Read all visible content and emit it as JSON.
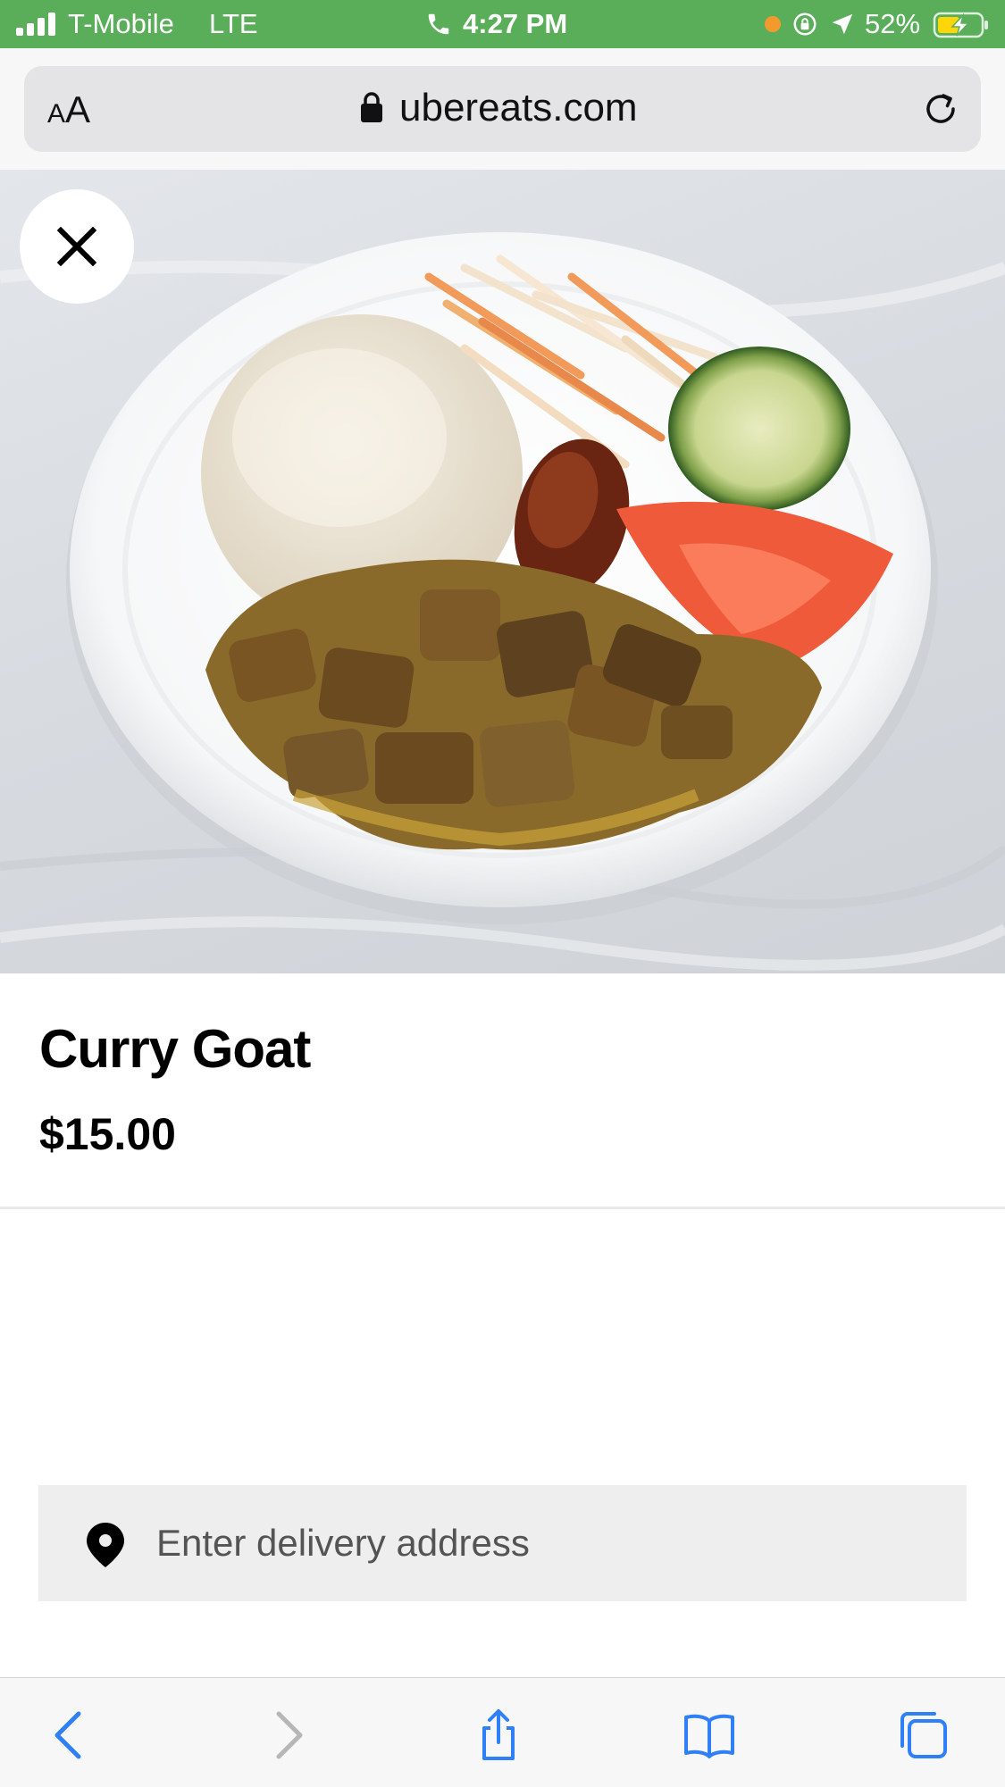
{
  "status_bar": {
    "carrier": "T-Mobile",
    "network": "LTE",
    "time": "4:27 PM",
    "battery_percent": "52%",
    "background_color": "#5aae5a"
  },
  "browser": {
    "text_size_button": "AA",
    "url": "ubereats.com"
  },
  "item": {
    "name": "Curry Goat",
    "price": "$15.00"
  },
  "delivery": {
    "placeholder": "Enter delivery address"
  },
  "icons": {
    "close": "close-icon",
    "pin": "location-pin-icon",
    "back": "chevron-left-icon",
    "forward": "chevron-right-icon",
    "share": "share-icon",
    "bookmarks": "book-icon",
    "tabs": "tabs-icon"
  }
}
